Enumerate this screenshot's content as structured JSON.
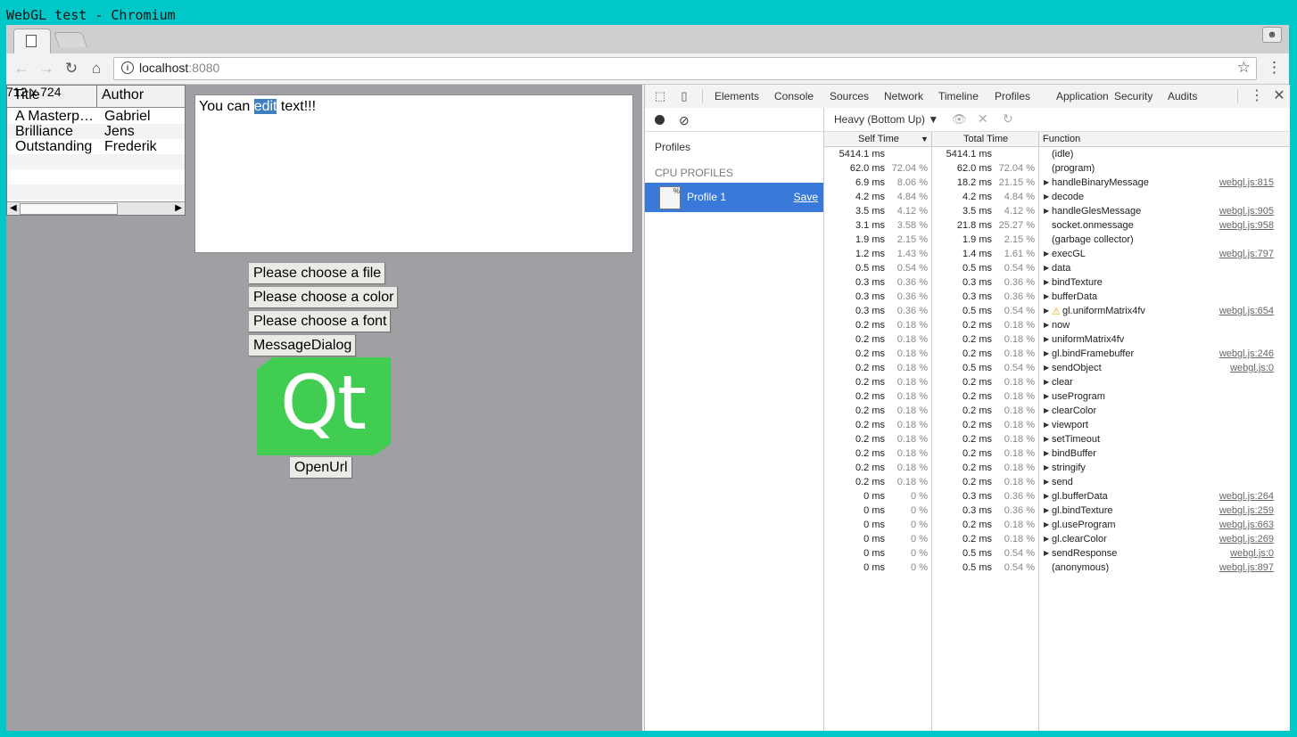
{
  "window": {
    "title": "WebGL test - Chromium"
  },
  "browser": {
    "url_host": "localhost",
    "url_port": ":8080",
    "icons": {
      "back": "arrow-left-icon",
      "forward": "arrow-right-icon",
      "reload": "reload-icon",
      "home": "home-icon",
      "star": "star-icon",
      "menu": "vertical-dots-icon",
      "page": "page-icon"
    }
  },
  "page": {
    "size_label": "712 x 724",
    "table": {
      "headers": [
        "Title",
        "Author"
      ],
      "rows": [
        [
          "A Masterp…",
          "Gabriel"
        ],
        [
          "Brilliance",
          "Jens"
        ],
        [
          "Outstanding",
          "Frederik"
        ]
      ]
    },
    "textedit": {
      "before": "You can ",
      "selected": "edit",
      "after": " text!!!"
    },
    "buttons": {
      "file": "Please choose a file",
      "color": "Please choose a color",
      "font": "Please choose a font",
      "message": "MessageDialog",
      "openurl": "OpenUrl"
    },
    "logo_text": "Qt",
    "colors": {
      "page_bg": "#a09fa4",
      "qt_green": "#41cd52",
      "selection": "#3d7fc1"
    }
  },
  "devtools": {
    "tabs": [
      "Elements",
      "Console",
      "Sources",
      "Network",
      "Timeline",
      "Profiles",
      "Application",
      "Security",
      "Audits"
    ],
    "active_tab": "Profiles",
    "sidebar": {
      "profiles_label": "Profiles",
      "cpu_profiles_label": "CPU PROFILES",
      "profile_name": "Profile 1",
      "save_label": "Save"
    },
    "mode": "Heavy (Bottom Up)",
    "columns": {
      "self": "Self Time",
      "total": "Total Time",
      "function": "Function"
    },
    "rows": [
      {
        "self": "5414.1 ms",
        "self_pct": "",
        "total": "5414.1 ms",
        "total_pct": "",
        "fn": "(idle)",
        "exp": false,
        "link": ""
      },
      {
        "self": "62.0 ms",
        "self_pct": "72.04 %",
        "total": "62.0 ms",
        "total_pct": "72.04 %",
        "fn": "(program)",
        "exp": false,
        "link": ""
      },
      {
        "self": "6.9 ms",
        "self_pct": "8.06 %",
        "total": "18.2 ms",
        "total_pct": "21.15 %",
        "fn": "handleBinaryMessage",
        "exp": true,
        "link": "webgl.js:815"
      },
      {
        "self": "4.2 ms",
        "self_pct": "4.84 %",
        "total": "4.2 ms",
        "total_pct": "4.84 %",
        "fn": "decode",
        "exp": true,
        "link": ""
      },
      {
        "self": "3.5 ms",
        "self_pct": "4.12 %",
        "total": "3.5 ms",
        "total_pct": "4.12 %",
        "fn": "handleGlesMessage",
        "exp": true,
        "link": "webgl.js:905"
      },
      {
        "self": "3.1 ms",
        "self_pct": "3.58 %",
        "total": "21.8 ms",
        "total_pct": "25.27 %",
        "fn": "socket.onmessage",
        "exp": false,
        "link": "webgl.js:958"
      },
      {
        "self": "1.9 ms",
        "self_pct": "2.15 %",
        "total": "1.9 ms",
        "total_pct": "2.15 %",
        "fn": "(garbage collector)",
        "exp": false,
        "link": ""
      },
      {
        "self": "1.2 ms",
        "self_pct": "1.43 %",
        "total": "1.4 ms",
        "total_pct": "1.61 %",
        "fn": "execGL",
        "exp": true,
        "link": "webgl.js:797"
      },
      {
        "self": "0.5 ms",
        "self_pct": "0.54 %",
        "total": "0.5 ms",
        "total_pct": "0.54 %",
        "fn": "data",
        "exp": true,
        "link": ""
      },
      {
        "self": "0.3 ms",
        "self_pct": "0.36 %",
        "total": "0.3 ms",
        "total_pct": "0.36 %",
        "fn": "bindTexture",
        "exp": true,
        "link": ""
      },
      {
        "self": "0.3 ms",
        "self_pct": "0.36 %",
        "total": "0.3 ms",
        "total_pct": "0.36 %",
        "fn": "bufferData",
        "exp": true,
        "link": ""
      },
      {
        "self": "0.3 ms",
        "self_pct": "0.36 %",
        "total": "0.5 ms",
        "total_pct": "0.54 %",
        "fn": "gl.uniformMatrix4fv",
        "exp": true,
        "warn": true,
        "link": "webgl.js:654"
      },
      {
        "self": "0.2 ms",
        "self_pct": "0.18 %",
        "total": "0.2 ms",
        "total_pct": "0.18 %",
        "fn": "now",
        "exp": true,
        "link": ""
      },
      {
        "self": "0.2 ms",
        "self_pct": "0.18 %",
        "total": "0.2 ms",
        "total_pct": "0.18 %",
        "fn": "uniformMatrix4fv",
        "exp": true,
        "link": ""
      },
      {
        "self": "0.2 ms",
        "self_pct": "0.18 %",
        "total": "0.2 ms",
        "total_pct": "0.18 %",
        "fn": "gl.bindFramebuffer",
        "exp": true,
        "link": "webgl.js:246"
      },
      {
        "self": "0.2 ms",
        "self_pct": "0.18 %",
        "total": "0.5 ms",
        "total_pct": "0.54 %",
        "fn": "sendObject",
        "exp": true,
        "link": "webgl.js:0"
      },
      {
        "self": "0.2 ms",
        "self_pct": "0.18 %",
        "total": "0.2 ms",
        "total_pct": "0.18 %",
        "fn": "clear",
        "exp": true,
        "link": ""
      },
      {
        "self": "0.2 ms",
        "self_pct": "0.18 %",
        "total": "0.2 ms",
        "total_pct": "0.18 %",
        "fn": "useProgram",
        "exp": true,
        "link": ""
      },
      {
        "self": "0.2 ms",
        "self_pct": "0.18 %",
        "total": "0.2 ms",
        "total_pct": "0.18 %",
        "fn": "clearColor",
        "exp": true,
        "link": ""
      },
      {
        "self": "0.2 ms",
        "self_pct": "0.18 %",
        "total": "0.2 ms",
        "total_pct": "0.18 %",
        "fn": "viewport",
        "exp": true,
        "link": ""
      },
      {
        "self": "0.2 ms",
        "self_pct": "0.18 %",
        "total": "0.2 ms",
        "total_pct": "0.18 %",
        "fn": "setTimeout",
        "exp": true,
        "link": ""
      },
      {
        "self": "0.2 ms",
        "self_pct": "0.18 %",
        "total": "0.2 ms",
        "total_pct": "0.18 %",
        "fn": "bindBuffer",
        "exp": true,
        "link": ""
      },
      {
        "self": "0.2 ms",
        "self_pct": "0.18 %",
        "total": "0.2 ms",
        "total_pct": "0.18 %",
        "fn": "stringify",
        "exp": true,
        "link": ""
      },
      {
        "self": "0.2 ms",
        "self_pct": "0.18 %",
        "total": "0.2 ms",
        "total_pct": "0.18 %",
        "fn": "send",
        "exp": true,
        "link": ""
      },
      {
        "self": "0 ms",
        "self_pct": "0 %",
        "total": "0.3 ms",
        "total_pct": "0.36 %",
        "fn": "gl.bufferData",
        "exp": true,
        "link": "webgl.js:264"
      },
      {
        "self": "0 ms",
        "self_pct": "0 %",
        "total": "0.3 ms",
        "total_pct": "0.36 %",
        "fn": "gl.bindTexture",
        "exp": true,
        "link": "webgl.js:259"
      },
      {
        "self": "0 ms",
        "self_pct": "0 %",
        "total": "0.2 ms",
        "total_pct": "0.18 %",
        "fn": "gl.useProgram",
        "exp": true,
        "link": "webgl.js:663"
      },
      {
        "self": "0 ms",
        "self_pct": "0 %",
        "total": "0.2 ms",
        "total_pct": "0.18 %",
        "fn": "gl.clearColor",
        "exp": true,
        "link": "webgl.js:269"
      },
      {
        "self": "0 ms",
        "self_pct": "0 %",
        "total": "0.5 ms",
        "total_pct": "0.54 %",
        "fn": "sendResponse",
        "exp": true,
        "link": "webgl.js:0"
      },
      {
        "self": "0 ms",
        "self_pct": "0 %",
        "total": "0.5 ms",
        "total_pct": "0.54 %",
        "fn": "(anonymous)",
        "exp": false,
        "link": "webgl.js:897"
      }
    ]
  }
}
